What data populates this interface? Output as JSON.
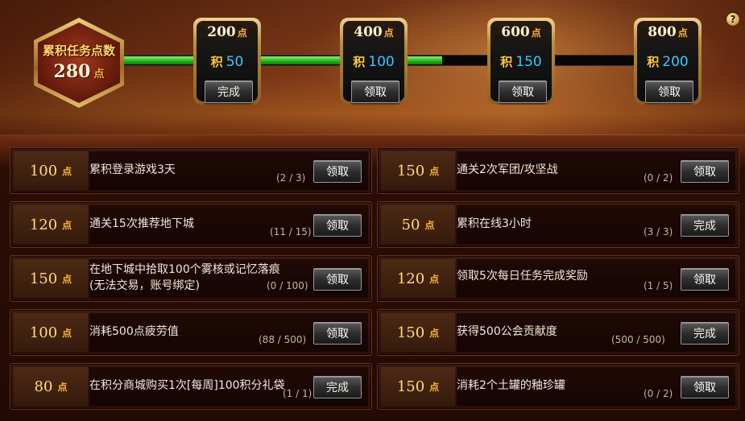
{
  "help_label": "?",
  "total": {
    "label": "累积任务点数",
    "value": "280",
    "unit": "点"
  },
  "progress_fraction": 0.62,
  "milestones": [
    {
      "points": "200",
      "unit": "点",
      "reward_icon": "积",
      "reward_value": "50",
      "button": "完成"
    },
    {
      "points": "400",
      "unit": "点",
      "reward_icon": "积",
      "reward_value": "100",
      "button": "领取"
    },
    {
      "points": "600",
      "unit": "点",
      "reward_icon": "积",
      "reward_value": "150",
      "button": "领取"
    },
    {
      "points": "800",
      "unit": "点",
      "reward_icon": "积",
      "reward_value": "200",
      "button": "领取"
    }
  ],
  "tasks": [
    {
      "points": "100",
      "unit": "点",
      "title": "累积登录游戏3天",
      "title2": "",
      "progress": "(2 / 3)",
      "button": "领取"
    },
    {
      "points": "150",
      "unit": "点",
      "title": "通关2次军团/攻坚战",
      "title2": "",
      "progress": "(0 / 2)",
      "button": "领取"
    },
    {
      "points": "120",
      "unit": "点",
      "title": "通关15次推荐地下城",
      "title2": "",
      "progress": "(11 / 15)",
      "button": "领取"
    },
    {
      "points": "50",
      "unit": "点",
      "title": "累积在线3小时",
      "title2": "",
      "progress": "(3 / 3)",
      "button": "完成"
    },
    {
      "points": "150",
      "unit": "点",
      "title": "在地下城中拾取100个雾核或记忆落痕",
      "title2": "(无法交易，账号绑定)",
      "progress": "(0 / 100)",
      "button": "领取"
    },
    {
      "points": "120",
      "unit": "点",
      "title": "领取5次每日任务完成奖励",
      "title2": "",
      "progress": "(1 / 5)",
      "button": "领取"
    },
    {
      "points": "100",
      "unit": "点",
      "title": "消耗500点疲劳值",
      "title2": "",
      "progress": "(88 / 500)",
      "button": "领取"
    },
    {
      "points": "150",
      "unit": "点",
      "title": "获得500公会贡献度",
      "title2": "",
      "progress": "(500 / 500)",
      "button": "完成"
    },
    {
      "points": "80",
      "unit": "点",
      "title": "在积分商城购买1次[每周]100积分礼袋",
      "title2": "",
      "progress": "(1 / 1)",
      "button": "完成"
    },
    {
      "points": "150",
      "unit": "点",
      "title": "消耗2个土罐的釉珍罐",
      "title2": "",
      "progress": "(0 / 2)",
      "button": "领取"
    }
  ]
}
